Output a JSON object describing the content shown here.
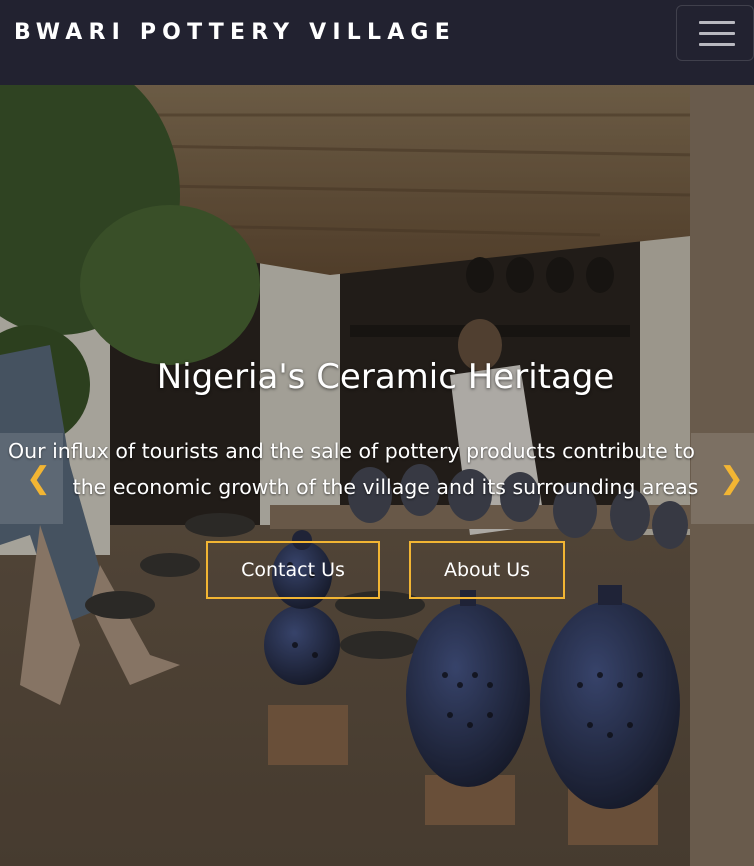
{
  "navbar": {
    "brand": "BWARI POTTERY VILLAGE",
    "menu_icon": "hamburger-menu-icon"
  },
  "hero": {
    "title": "Nigeria's Ceramic Heritage",
    "subtitle_line1": "Our influx of tourists and the sale of pottery products contribute to",
    "subtitle_line2": "the economic growth of the village and its surrounding areas",
    "prev_icon": "chevron-left-icon",
    "next_icon": "chevron-right-icon",
    "buttons": {
      "contact": "Contact Us",
      "about": "About Us"
    }
  },
  "colors": {
    "navbar_bg": "#222230",
    "accent": "#f2b533",
    "text": "#ffffff"
  }
}
